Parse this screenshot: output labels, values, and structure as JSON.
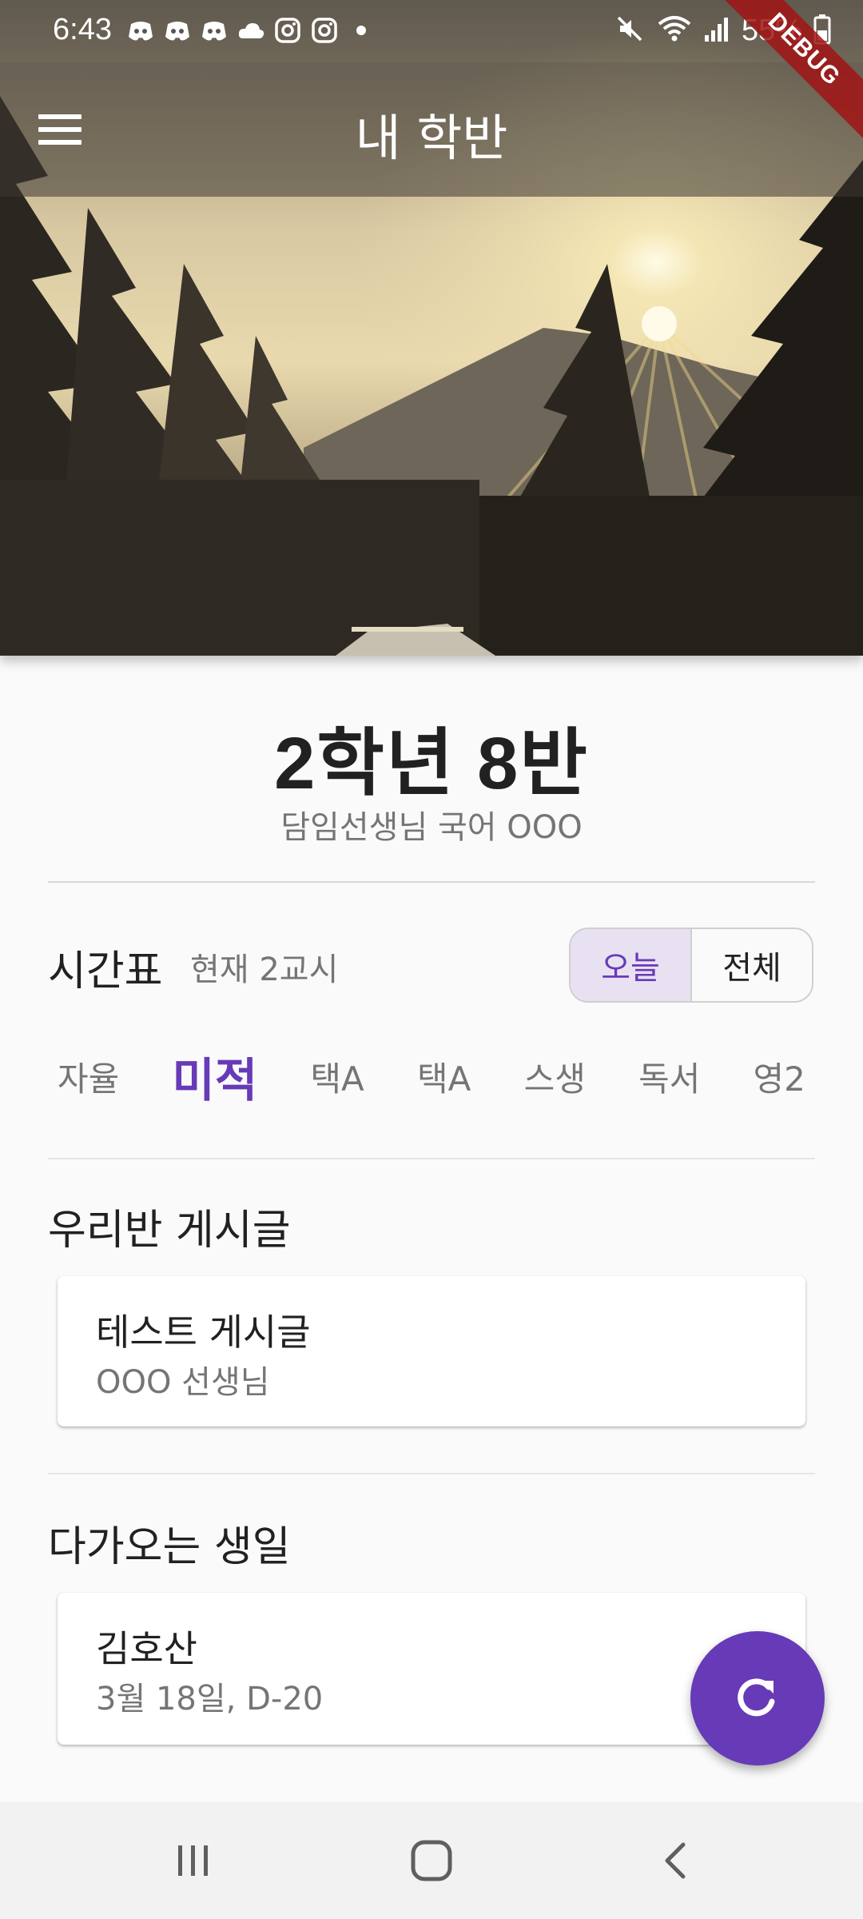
{
  "status_bar": {
    "time": "6:43",
    "battery": "55%",
    "notification_icons": [
      "discord-icon",
      "discord-icon",
      "discord-icon",
      "cloud-icon",
      "instagram-icon",
      "instagram-icon",
      "dot-icon"
    ],
    "system_icons": [
      "mute-icon",
      "wifi-icon",
      "signal-icon",
      "battery-icon"
    ]
  },
  "app_bar": {
    "title": "내 학반",
    "menu_icon": "menu-icon"
  },
  "debug_banner": "DEBUG",
  "class_info": {
    "title": "2학년 8반",
    "homeroom": "담임선생님 국어 OOO"
  },
  "timetable": {
    "heading": "시간표",
    "current_period": "현재 2교시",
    "toggle": {
      "today": "오늘",
      "all": "전체",
      "selected": "today"
    },
    "periods": [
      "자율",
      "미적",
      "택A",
      "택A",
      "스생",
      "독서",
      "영2"
    ],
    "current_index": 1
  },
  "posts": {
    "heading": "우리반 게시글",
    "items": [
      {
        "title": "테스트 게시글",
        "author": "OOO 선생님"
      }
    ]
  },
  "birthdays": {
    "heading": "다가오는 생일",
    "items": [
      {
        "name": "김호산",
        "date": "3월 18일, D-20"
      }
    ]
  },
  "fab": {
    "icon": "refresh-icon"
  },
  "nav_bar": {
    "buttons": [
      "recent-apps-icon",
      "home-icon",
      "back-icon"
    ]
  },
  "colors": {
    "accent": "#673ab7",
    "accent_light": "#e8e1f1",
    "text_secondary": "#757575",
    "background": "#fafafa"
  }
}
